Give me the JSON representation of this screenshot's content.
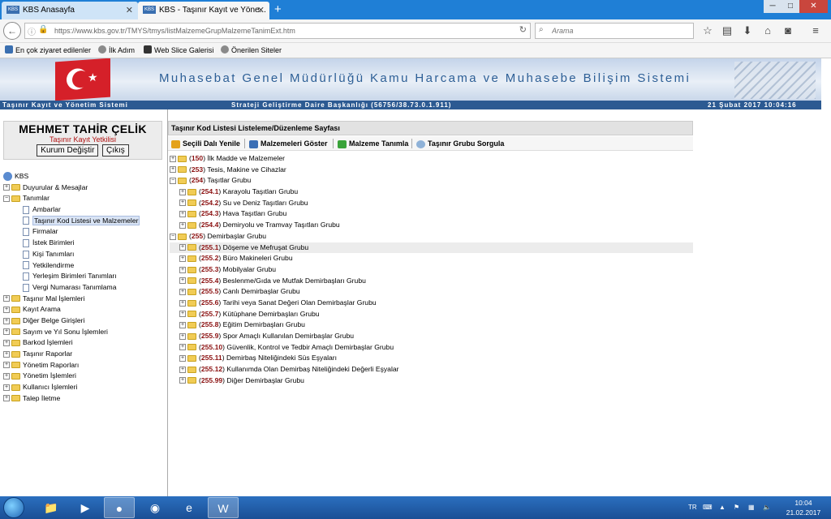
{
  "browser": {
    "tabs": [
      {
        "label": "KBS Anasayfa",
        "favicon": "KBS"
      },
      {
        "label": "KBS - Taşınır Kayıt ve Yöne...",
        "favicon": "KBS"
      }
    ],
    "url": "https://www.kbs.gov.tr/TMYS/tmys/listMalzemeGrupMalzemeTanimExt.htm",
    "search_placeholder": "Arama",
    "bookmarks": [
      "En çok ziyaret edilenler",
      "İlk Adım",
      "Web Slice Galerisi",
      "Önerilen Siteler"
    ]
  },
  "banner": {
    "title": "Muhasebat Genel Müdürlüğü Kamu Harcama ve Muhasebe Bilişim Sistemi",
    "system": "Taşınır Kayıt ve Yönetim Sistemi",
    "department": "Strateji Geliştirme Daire Başkanlığı (56756/38.73.0.1.911)",
    "datetime": "21 Şubat 2017 10:04:16",
    "colors": {
      "strip": "#2c5a92",
      "title": "#2d5f96"
    }
  },
  "user": {
    "name": "MEHMET TAHİR ÇELİK",
    "role": "Taşınır Kayıt Yetkilisi",
    "change_button": "Kurum Değiştir",
    "logout_button": "Çıkış"
  },
  "nav": {
    "root": "KBS",
    "items": [
      {
        "label": "Duyurular & Mesajlar",
        "state": "collapsed"
      },
      {
        "label": "Tanımlar",
        "state": "expanded",
        "children": [
          "Ambarlar",
          "Taşınır Kod Listesi ve Malzemeler",
          "Firmalar",
          "İstek Birimleri",
          "Kişi Tanımları",
          "Yetkilendirme",
          "Yerleşim Birimleri Tanımları",
          "Vergi Numarası Tanımlama"
        ],
        "selected_child": "Taşınır Kod Listesi ve Malzemeler"
      },
      {
        "label": "Taşınır Mal İşlemleri",
        "state": "collapsed"
      },
      {
        "label": "Kayıt Arama",
        "state": "collapsed"
      },
      {
        "label": "Diğer Belge Girişleri",
        "state": "collapsed"
      },
      {
        "label": "Sayım ve Yıl Sonu İşlemleri",
        "state": "collapsed"
      },
      {
        "label": "Barkod İşlemleri",
        "state": "collapsed"
      },
      {
        "label": "Taşınır Raporlar",
        "state": "collapsed"
      },
      {
        "label": "Yönetim Raporları",
        "state": "collapsed"
      },
      {
        "label": "Yönetim İşlemleri",
        "state": "collapsed"
      },
      {
        "label": "Kullanıcı İşlemleri",
        "state": "collapsed"
      },
      {
        "label": "Talep İletme",
        "state": "collapsed"
      }
    ]
  },
  "page": {
    "title": "Taşınır Kod Listesi Listeleme/Düzenleme Sayfası",
    "toolbar": [
      "Seçili Dalı Yenile",
      "Malzemeleri Göster",
      "Malzeme Tanımla",
      "Taşınır Grubu Sorgula"
    ]
  },
  "code_tree": [
    {
      "level": 0,
      "code": "150",
      "name": "İlk Madde ve Malzemeler",
      "state": "collapsed"
    },
    {
      "level": 0,
      "code": "253",
      "name": "Tesis, Makine ve Cihazlar",
      "state": "collapsed"
    },
    {
      "level": 0,
      "code": "254",
      "name": "Taşıtlar Grubu",
      "state": "expanded"
    },
    {
      "level": 1,
      "code": "254.1",
      "name": "Karayolu Taşıtları Grubu",
      "state": "collapsed"
    },
    {
      "level": 1,
      "code": "254.2",
      "name": "Su ve Deniz Taşıtları Grubu",
      "state": "collapsed"
    },
    {
      "level": 1,
      "code": "254.3",
      "name": "Hava Taşıtları Grubu",
      "state": "collapsed"
    },
    {
      "level": 1,
      "code": "254.4",
      "name": "Demiryolu ve Tramvay Taşıtları Grubu",
      "state": "collapsed"
    },
    {
      "level": 0,
      "code": "255",
      "name": "Demirbaşlar Grubu",
      "state": "expanded"
    },
    {
      "level": 1,
      "code": "255.1",
      "name": "Döşeme ve Mefruşat Grubu",
      "state": "collapsed",
      "highlighted": true
    },
    {
      "level": 1,
      "code": "255.2",
      "name": "Büro Makineleri Grubu",
      "state": "collapsed"
    },
    {
      "level": 1,
      "code": "255.3",
      "name": "Mobilyalar Grubu",
      "state": "collapsed"
    },
    {
      "level": 1,
      "code": "255.4",
      "name": "Beslenme/Gıda ve Mutfak Demirbaşları Grubu",
      "state": "collapsed"
    },
    {
      "level": 1,
      "code": "255.5",
      "name": "Canlı Demirbaşlar Grubu",
      "state": "collapsed"
    },
    {
      "level": 1,
      "code": "255.6",
      "name": "Tarihi veya Sanat Değeri Olan Demirbaşlar Grubu",
      "state": "collapsed"
    },
    {
      "level": 1,
      "code": "255.7",
      "name": "Kütüphane Demirbaşları Grubu",
      "state": "collapsed"
    },
    {
      "level": 1,
      "code": "255.8",
      "name": "Eğitim Demirbaşları Grubu",
      "state": "collapsed"
    },
    {
      "level": 1,
      "code": "255.9",
      "name": "Spor Amaçlı Kullanılan Demirbaşlar Grubu",
      "state": "collapsed"
    },
    {
      "level": 1,
      "code": "255.10",
      "name": "Güvenlik, Kontrol ve Tedbir Amaçlı Demirbaşlar Grubu",
      "state": "collapsed"
    },
    {
      "level": 1,
      "code": "255.11",
      "name": "Demirbaş Niteliğindeki Süs Eşyaları",
      "state": "collapsed"
    },
    {
      "level": 1,
      "code": "255.12",
      "name": "Kullanımda Olan Demirbaş Niteliğindeki Değerli Eşyalar",
      "state": "collapsed"
    },
    {
      "level": 1,
      "code": "255.99",
      "name": "Diğer Demirbaşlar Grubu",
      "state": "collapsed"
    }
  ],
  "taskbar": {
    "lang": "TR",
    "time": "10:04",
    "date": "21.02.2017"
  }
}
